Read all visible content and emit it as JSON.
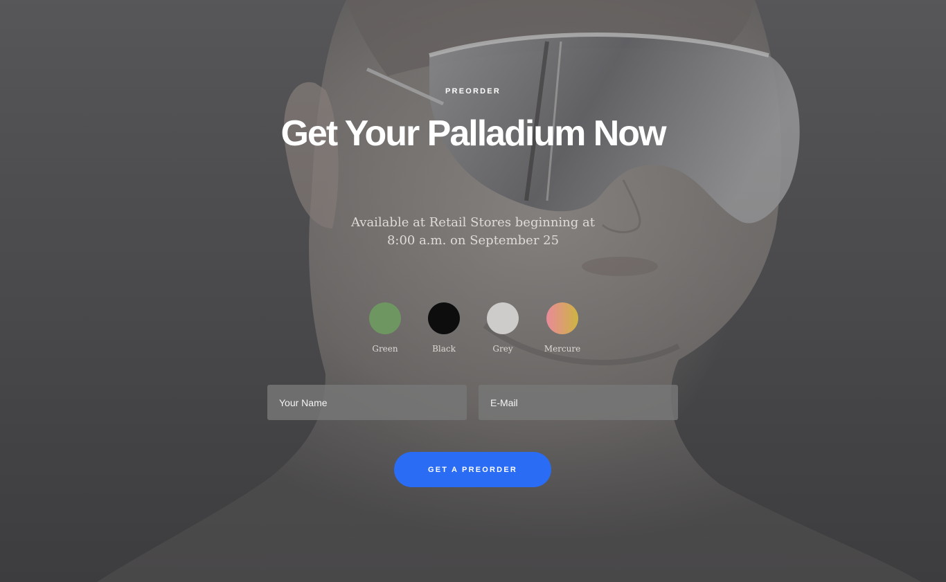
{
  "hero": {
    "eyebrow": "PREORDER",
    "title": "Get Your Palladium Now",
    "subtitle_line1": "Available at Retail Stores beginning at",
    "subtitle_line2": "8:00 a.m. on September 25"
  },
  "colors": [
    {
      "label": "Green",
      "color": "#6e9660"
    },
    {
      "label": "Black",
      "color": "#0d0d0d"
    },
    {
      "label": "Grey",
      "color": "#cdcccb"
    },
    {
      "label": "Mercure",
      "gradient": [
        "#e98a9a",
        "#cdb442"
      ]
    }
  ],
  "form": {
    "name_placeholder": "Your Name",
    "email_placeholder": "E-Mail",
    "submit_label": "GET A PREORDER"
  },
  "theme": {
    "accent": "#2a6cf3",
    "text": "#ffffff"
  }
}
